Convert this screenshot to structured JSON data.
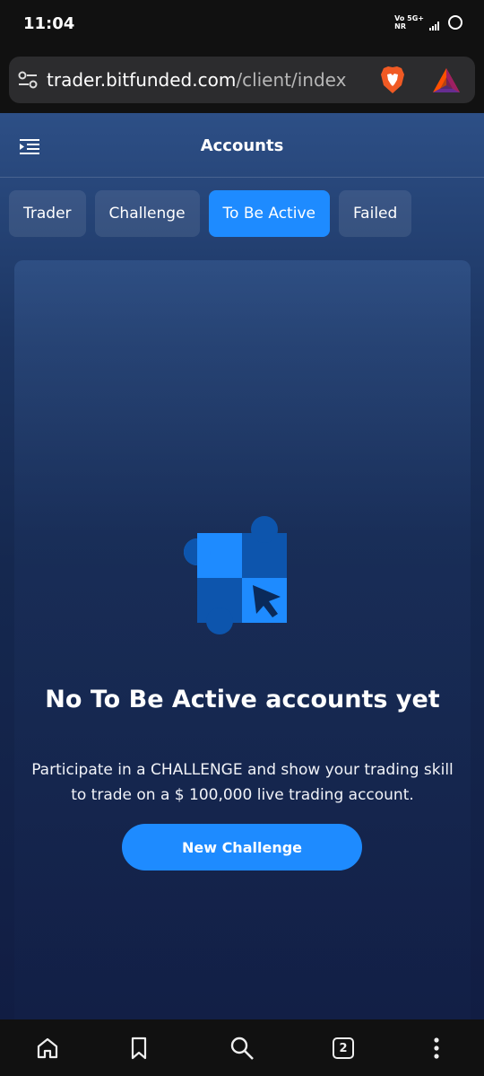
{
  "status_bar": {
    "time": "11:04",
    "network_top": "Vo 5G+",
    "network_bottom": "NR"
  },
  "browser": {
    "url_host": "trader.bitfunded.com",
    "url_path": "/client/index",
    "tab_count": "2"
  },
  "header": {
    "title": "Accounts"
  },
  "tabs": [
    {
      "label": "Trader",
      "active": false
    },
    {
      "label": "Challenge",
      "active": false
    },
    {
      "label": "To Be Active",
      "active": true
    },
    {
      "label": "Failed",
      "active": false
    }
  ],
  "empty_state": {
    "title": "No To Be Active accounts yet",
    "description": "Participate in a CHALLENGE and show your trading skill to trade on a $ 100,000 live trading account.",
    "button_label": "New Challenge"
  },
  "icons": {
    "menu": "menu-collapse-icon",
    "tune": "site-settings-icon",
    "brave": "brave-shield-icon",
    "bat": "bat-rewards-icon",
    "home": "home-icon",
    "bookmark": "bookmark-icon",
    "search": "search-icon",
    "tabs": "tabs-icon",
    "more": "more-vert-icon"
  },
  "colors": {
    "accent": "#1e8bff",
    "background": "#15284f"
  }
}
